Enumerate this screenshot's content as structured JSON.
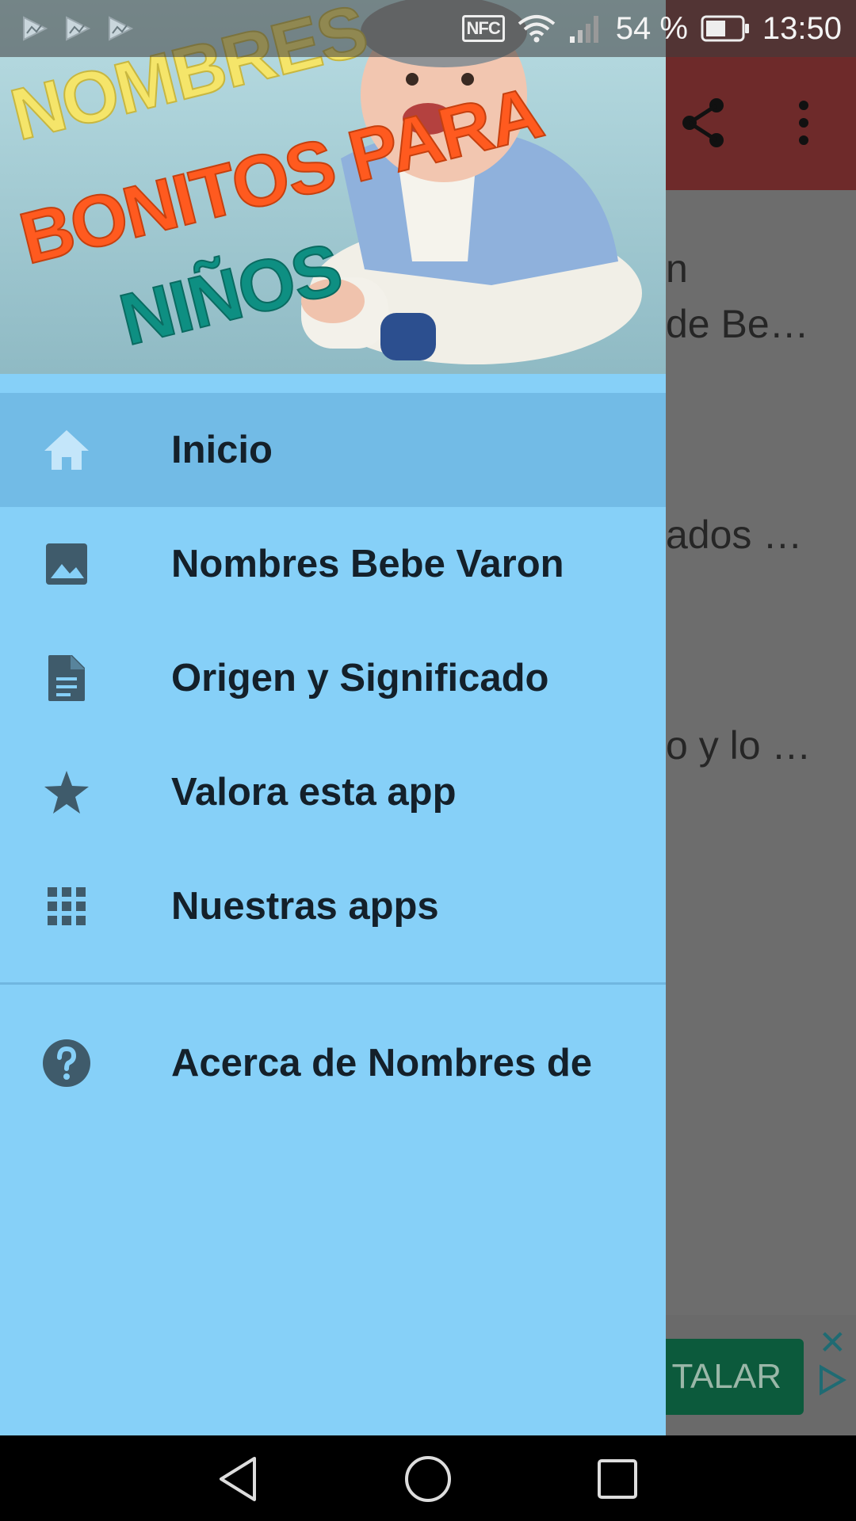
{
  "status_bar": {
    "battery_percent": "54 %",
    "time": "13:50",
    "nfc_label": "NFC",
    "notification_icons": [
      "photo-flag-icon",
      "photo-flag-icon",
      "photo-flag-icon"
    ]
  },
  "background_app": {
    "toolbar_color": "#6e2a2a",
    "lines": [
      {
        "text": "n"
      },
      {
        "text": "de Be…"
      },
      {
        "text": "ados …"
      },
      {
        "text": "o y lo …"
      }
    ],
    "ad_button_label": "TALAR"
  },
  "drawer": {
    "header_image": {
      "line1": "NOMBRES",
      "line2": "BONITOS PARA",
      "line3": "NIÑOS"
    },
    "items": [
      {
        "label": "Inicio",
        "icon": "home-icon",
        "active": true
      },
      {
        "label": "Nombres Bebe Varon",
        "icon": "image-icon",
        "active": false
      },
      {
        "label": "Origen y Significado",
        "icon": "document-icon",
        "active": false
      },
      {
        "label": "Valora esta app",
        "icon": "star-icon",
        "active": false
      },
      {
        "label": "Nuestras apps",
        "icon": "apps-grid-icon",
        "active": false
      }
    ],
    "about": {
      "label": "Acerca de Nombres de",
      "icon": "help-icon"
    },
    "background_color": "#86d0f8",
    "active_color": "#72bbe6",
    "icon_color": "#3f5b6b"
  },
  "nav_bar": {
    "buttons": [
      "back-icon",
      "home-circle-icon",
      "recents-icon"
    ]
  }
}
